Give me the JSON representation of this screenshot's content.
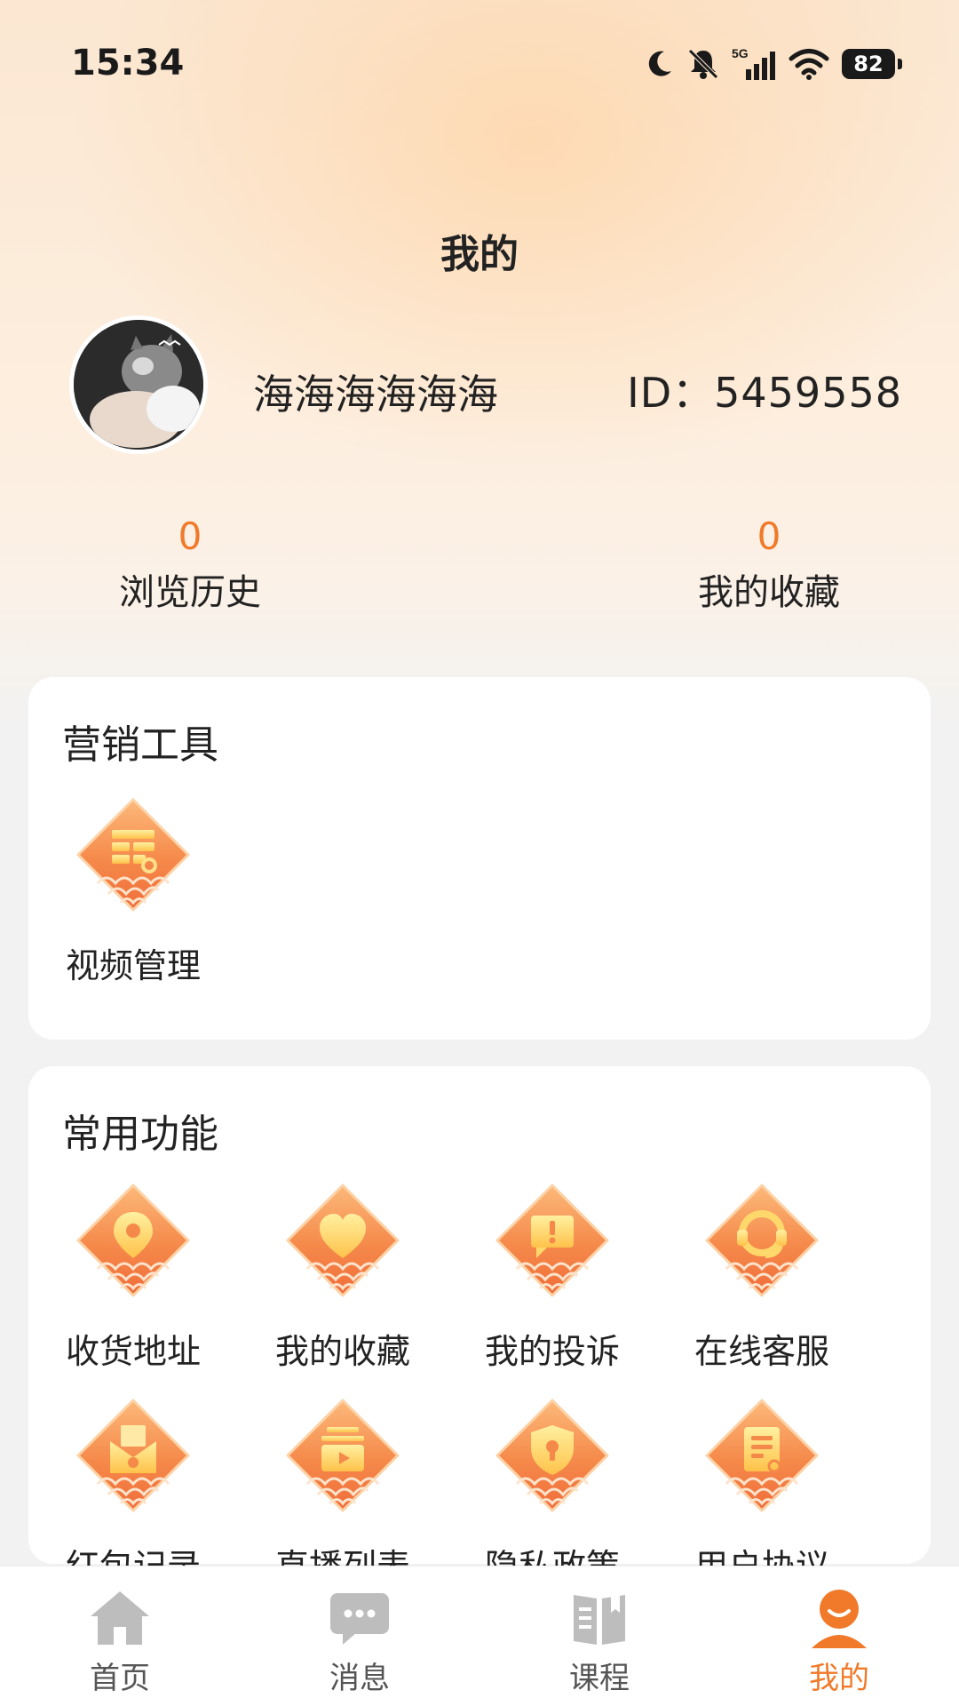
{
  "status_bar": {
    "time": "15:34",
    "signal": "5G",
    "battery": "82"
  },
  "header": {
    "title": "我的"
  },
  "profile": {
    "username": "海海海海海海",
    "user_id": "ID：5459558"
  },
  "stats": [
    {
      "count": "0",
      "label": "浏览历史"
    },
    {
      "count": "0",
      "label": "我的收藏"
    }
  ],
  "marketing": {
    "title": "营销工具",
    "items": [
      {
        "label": "视频管理",
        "icon": "video-manage-icon"
      }
    ]
  },
  "common": {
    "title": "常用功能",
    "items": [
      {
        "label": "收货地址",
        "icon": "location-pin-icon"
      },
      {
        "label": "我的收藏",
        "icon": "heart-icon"
      },
      {
        "label": "我的投诉",
        "icon": "complaint-icon"
      },
      {
        "label": "在线客服",
        "icon": "headset-icon"
      },
      {
        "label": "红包记录",
        "icon": "red-envelope-icon"
      },
      {
        "label": "直播列表",
        "icon": "live-tv-icon"
      },
      {
        "label": "隐私政策",
        "icon": "shield-lock-icon"
      },
      {
        "label": "用户协议",
        "icon": "agreement-icon"
      }
    ]
  },
  "tabbar": {
    "items": [
      {
        "label": "首页",
        "icon": "home-icon"
      },
      {
        "label": "消息",
        "icon": "message-icon"
      },
      {
        "label": "课程",
        "icon": "book-icon"
      },
      {
        "label": "我的",
        "icon": "profile-icon"
      }
    ],
    "active_index": 3
  },
  "colors": {
    "accent": "#f07a2a",
    "tile_orange": "#f5894a",
    "tile_light": "#fbc27e",
    "icon_gold": "#ffd86b"
  }
}
